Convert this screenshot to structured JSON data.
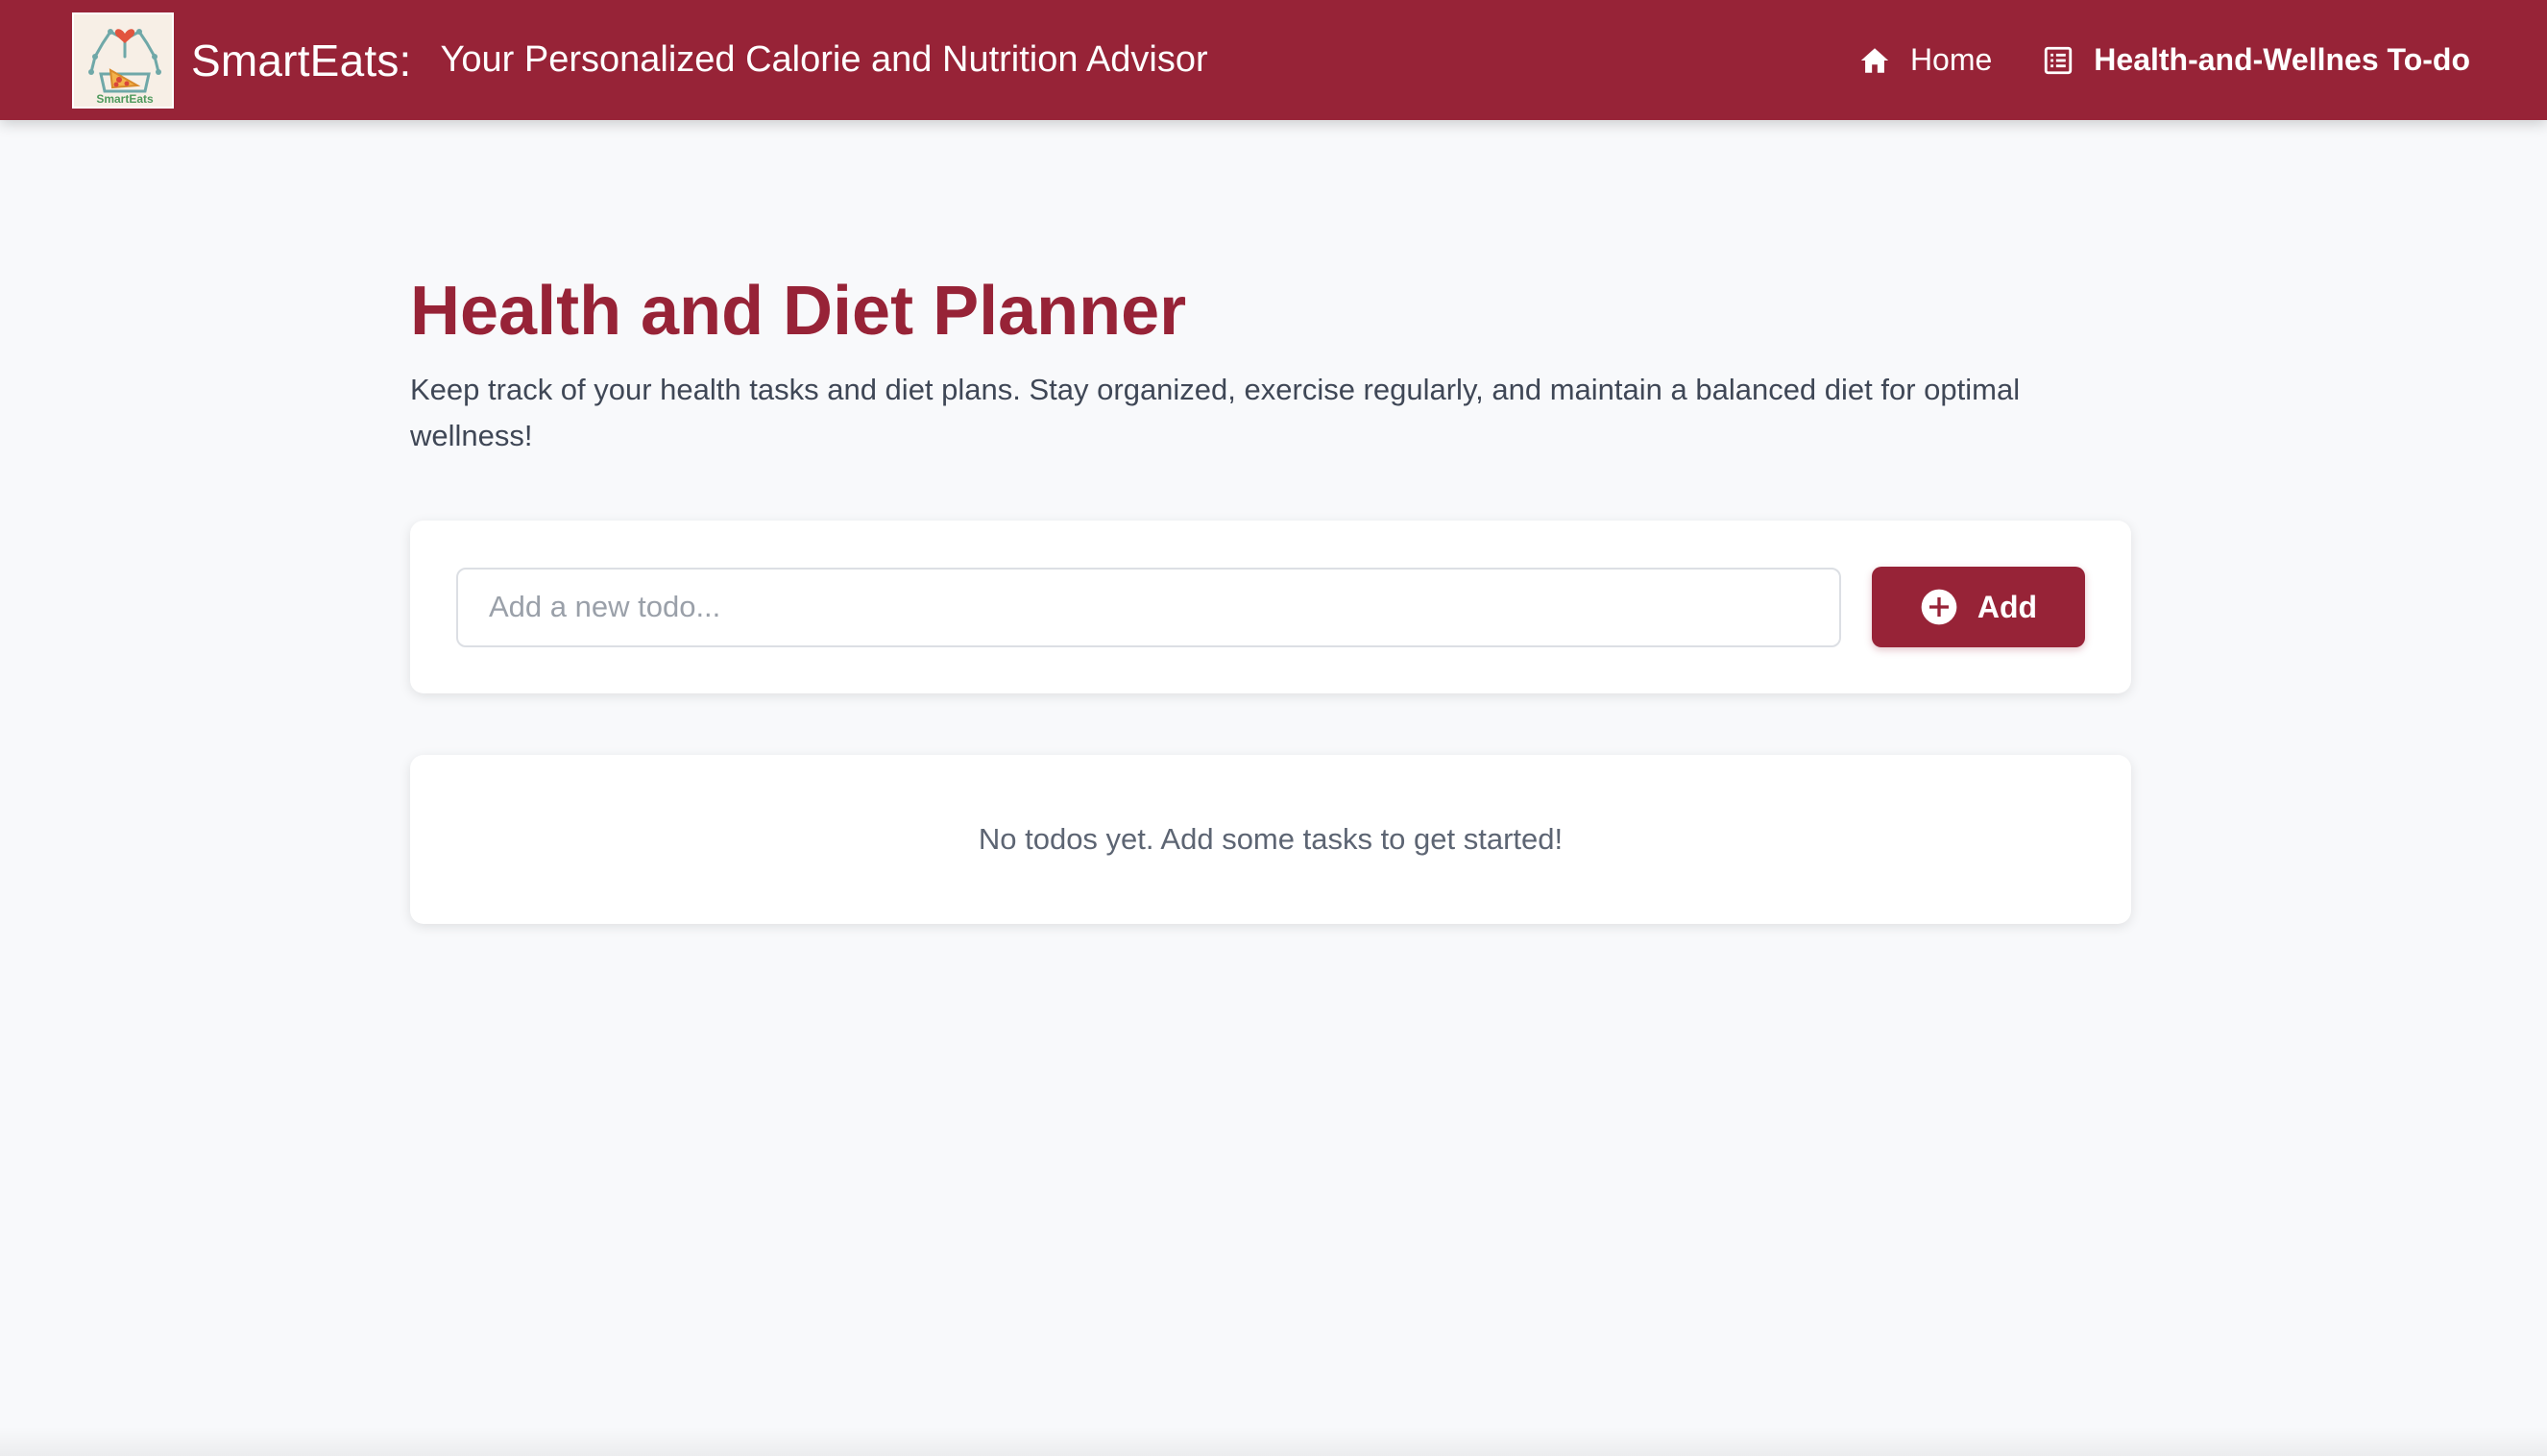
{
  "header": {
    "logo_text": "SmartEats",
    "brand_name": "SmartEats:",
    "tagline": "Your Personalized Calorie and Nutrition Advisor",
    "nav": [
      {
        "label": "Home",
        "icon": "home-icon",
        "active": false
      },
      {
        "label": "Health-and-Wellnes To-do",
        "icon": "list-icon",
        "active": true
      }
    ]
  },
  "main": {
    "title": "Health and Diet Planner",
    "description": "Keep track of your health tasks and diet plans. Stay organized, exercise regularly, and maintain a balanced diet for optimal wellness!",
    "add_form": {
      "placeholder": "Add a new todo...",
      "value": "",
      "button_label": "Add",
      "button_icon": "plus-circle-icon"
    },
    "empty_message": "No todos yet. Add some tasks to get started!"
  },
  "colors": {
    "brand": "#972337",
    "background": "#f8f9fb",
    "card": "#ffffff",
    "text_muted": "#5d6573"
  }
}
